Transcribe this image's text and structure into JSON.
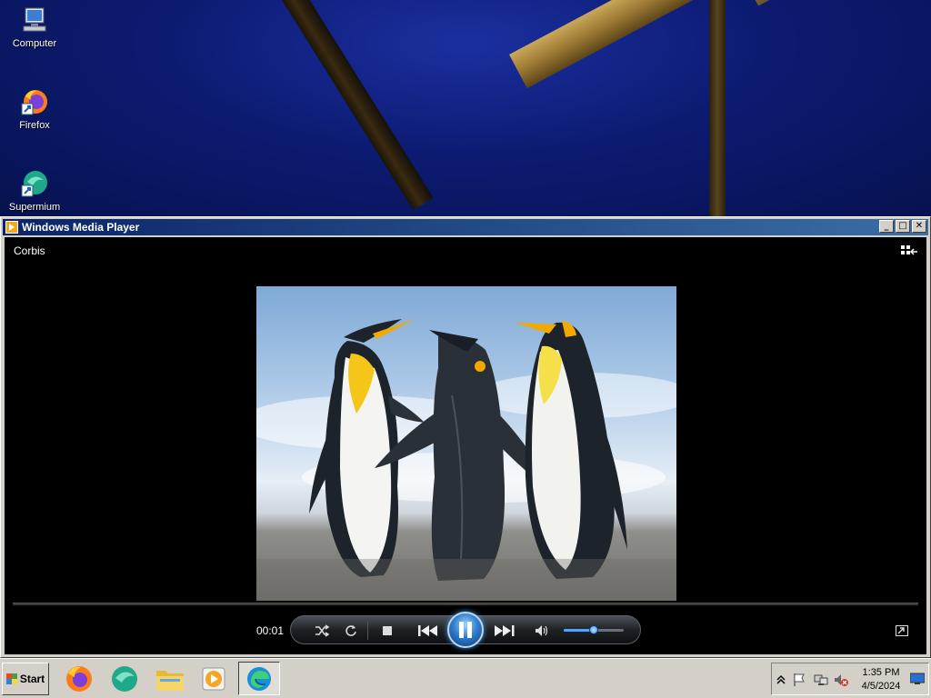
{
  "desktop": {
    "icons": [
      {
        "label": "Computer",
        "icon": "computer-icon"
      },
      {
        "label": "Firefox",
        "icon": "firefox-icon"
      },
      {
        "label": "Supermium",
        "icon": "supermium-icon"
      }
    ]
  },
  "window": {
    "title": "Windows Media Player",
    "minimize": "_",
    "maximize": "□",
    "close": "✕"
  },
  "player": {
    "media_label": "Corbis",
    "time": "00:01",
    "state": "playing",
    "volume_level": 0.5,
    "video_subject": "three emperor penguins",
    "accent": "#2f7fd0"
  },
  "taskbar": {
    "start_label": "Start",
    "apps": [
      "firefox-icon",
      "supermium-icon",
      "file-explorer-icon",
      "media-player-icon",
      "edge-icon"
    ],
    "clock_time": "1:35 PM",
    "clock_date": "4/5/2024"
  }
}
